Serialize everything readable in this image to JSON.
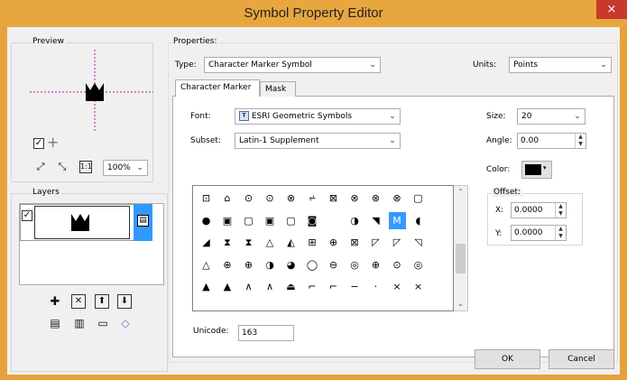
{
  "window": {
    "title": "Symbol Property Editor",
    "close_glyph": "×",
    "accent": "#e8a63f",
    "close_color": "#c7382d"
  },
  "preview": {
    "label": "Preview",
    "zoom": "100%",
    "fit_glyph": "⤢",
    "expand_glyph": "⤡",
    "actual_glyph": "1:1",
    "add_glyph": "+"
  },
  "layers": {
    "label": "Layers",
    "add_glyph": "✚",
    "remove_glyph": "✕",
    "up_glyph": "⬆",
    "down_glyph": "⬇"
  },
  "properties": {
    "label": "Properties:",
    "type_label": "Type:",
    "type_value": "Character Marker Symbol",
    "units_label": "Units:",
    "units_value": "Points"
  },
  "tabs": [
    {
      "label": "Character Marker"
    },
    {
      "label": "Mask"
    }
  ],
  "character_marker": {
    "font_label": "Font:",
    "font_value": "ESRI Geometric Symbols",
    "font_badge": "Ŧ",
    "subset_label": "Subset:",
    "subset_value": "Latin-1 Supplement",
    "size_label": "Size:",
    "size_value": "20",
    "angle_label": "Angle:",
    "angle_value": "0.00",
    "color_label": "Color:",
    "offset_label": "Offset:",
    "offset_x_label": "X:",
    "offset_x_value": "0.0000",
    "offset_y_label": "Y:",
    "offset_y_value": "0.0000",
    "unicode_label": "Unicode:",
    "unicode_value": "163"
  },
  "glyph_rows": [
    [
      "⊡",
      "⌂",
      "⊙",
      "⊙",
      "⊗",
      "⩫",
      "⊠",
      "⊗",
      "⊗",
      "⊗",
      "▢"
    ],
    [
      "●",
      "▣",
      "▢",
      "▣",
      "▢",
      "◙",
      "",
      "◑",
      "◥",
      "M",
      "◖"
    ],
    [
      "◢",
      "⧗",
      "⧗",
      "△",
      "◭",
      "⊞",
      "⊕",
      "⊠",
      "◸",
      "◸",
      "◹"
    ],
    [
      "△",
      "⊕",
      "⊕",
      "◑",
      "◕",
      "◯",
      "⊖",
      "◎",
      "⊕",
      "⊙",
      "◎"
    ],
    [
      "▲",
      "▲",
      "∧",
      "∧",
      "⏏",
      "⌐",
      "⌐",
      "−",
      "·",
      "×",
      "×"
    ]
  ],
  "selected_glyph": {
    "row": 1,
    "col": 9
  },
  "buttons": {
    "ok": "OK",
    "cancel": "Cancel"
  }
}
